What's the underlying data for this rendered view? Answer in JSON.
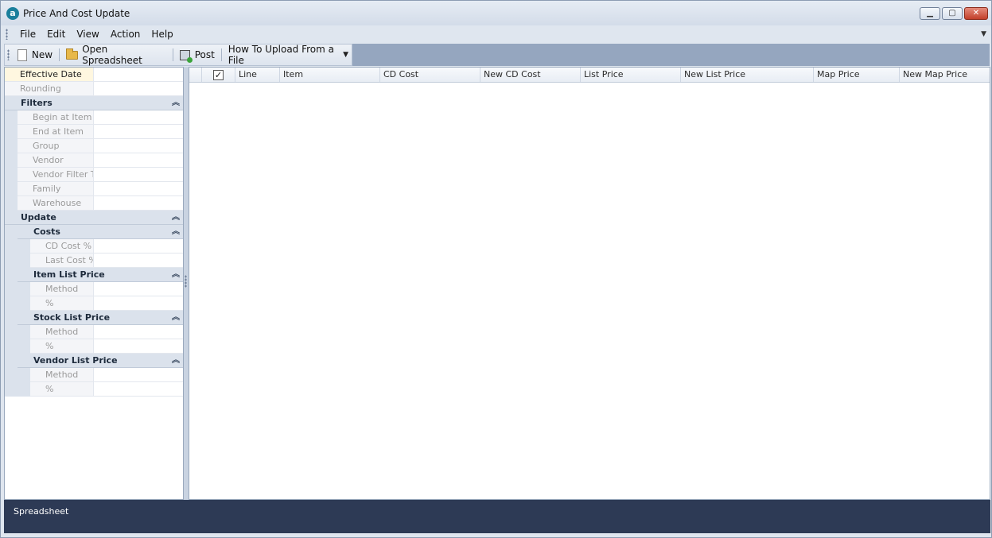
{
  "window": {
    "title": "Price And Cost Update",
    "app_icon_letter": "a"
  },
  "menu": [
    "File",
    "Edit",
    "View",
    "Action",
    "Help"
  ],
  "toolbar": {
    "new_label": "New",
    "open_spreadsheet_label": "Open Spreadsheet",
    "post_label": "Post",
    "how_to_upload_label": "How To Upload From a File"
  },
  "left": {
    "effective_date": "Effective Date",
    "rounding": "Rounding",
    "filters": {
      "header": "Filters",
      "items": [
        "Begin at Item",
        "End at Item",
        "Group",
        "Vendor",
        "Vendor Filter T",
        "Family",
        "Warehouse"
      ]
    },
    "update": {
      "header": "Update",
      "costs": {
        "header": "Costs",
        "items": [
          "CD Cost %",
          "Last Cost %"
        ]
      },
      "item_list_price": {
        "header": "Item List Price",
        "items": [
          "Method",
          "%"
        ]
      },
      "stock_list_price": {
        "header": "Stock List Price",
        "items": [
          "Method",
          "%"
        ]
      },
      "vendor_list_price": {
        "header": "Vendor List Price",
        "items": [
          "Method",
          "%"
        ]
      }
    }
  },
  "grid": {
    "check_mark": "✓",
    "columns": [
      "Line",
      "Item",
      "CD Cost",
      "New CD Cost",
      "List Price",
      "New List Price",
      "Map Price",
      "New Map Price"
    ]
  },
  "bottom": {
    "tab_label": "Spreadsheet"
  }
}
